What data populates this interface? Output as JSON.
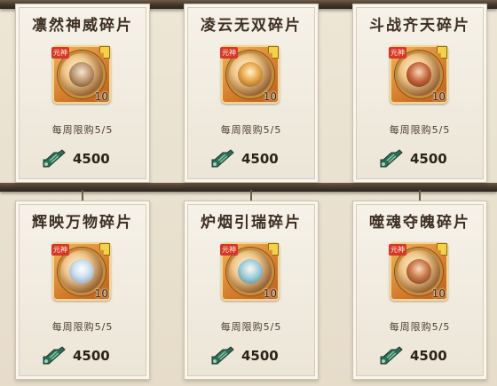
{
  "cards": [
    {
      "title": "凛然神威碎片",
      "tag": "元神",
      "count": "10",
      "limit": "每周限购5/5",
      "price": "4500"
    },
    {
      "title": "凌云无双碎片",
      "tag": "元神",
      "count": "10",
      "limit": "每周限购5/5",
      "price": "4500"
    },
    {
      "title": "斗战齐天碎片",
      "tag": "元神",
      "count": "10",
      "limit": "每周限购5/5",
      "price": "4500"
    },
    {
      "title": "辉映万物碎片",
      "tag": "元神",
      "count": "10",
      "limit": "每周限购5/5",
      "price": "4500"
    },
    {
      "title": "炉烟引瑞碎片",
      "tag": "元神",
      "count": "10",
      "limit": "每周限购5/5",
      "price": "4500"
    },
    {
      "title": "噬魂夺魄碎片",
      "tag": "元神",
      "count": "10",
      "limit": "每周限购5/5",
      "price": "4500"
    }
  ],
  "colors": {
    "card_bg": "#f3eee4",
    "frame_orange": "#d47b2b",
    "tag_red": "#d8362a",
    "currency_green": "#2f6b55"
  },
  "icons": {
    "currency": "jade-currency-icon",
    "fragment": "fragment-badge-icon"
  }
}
